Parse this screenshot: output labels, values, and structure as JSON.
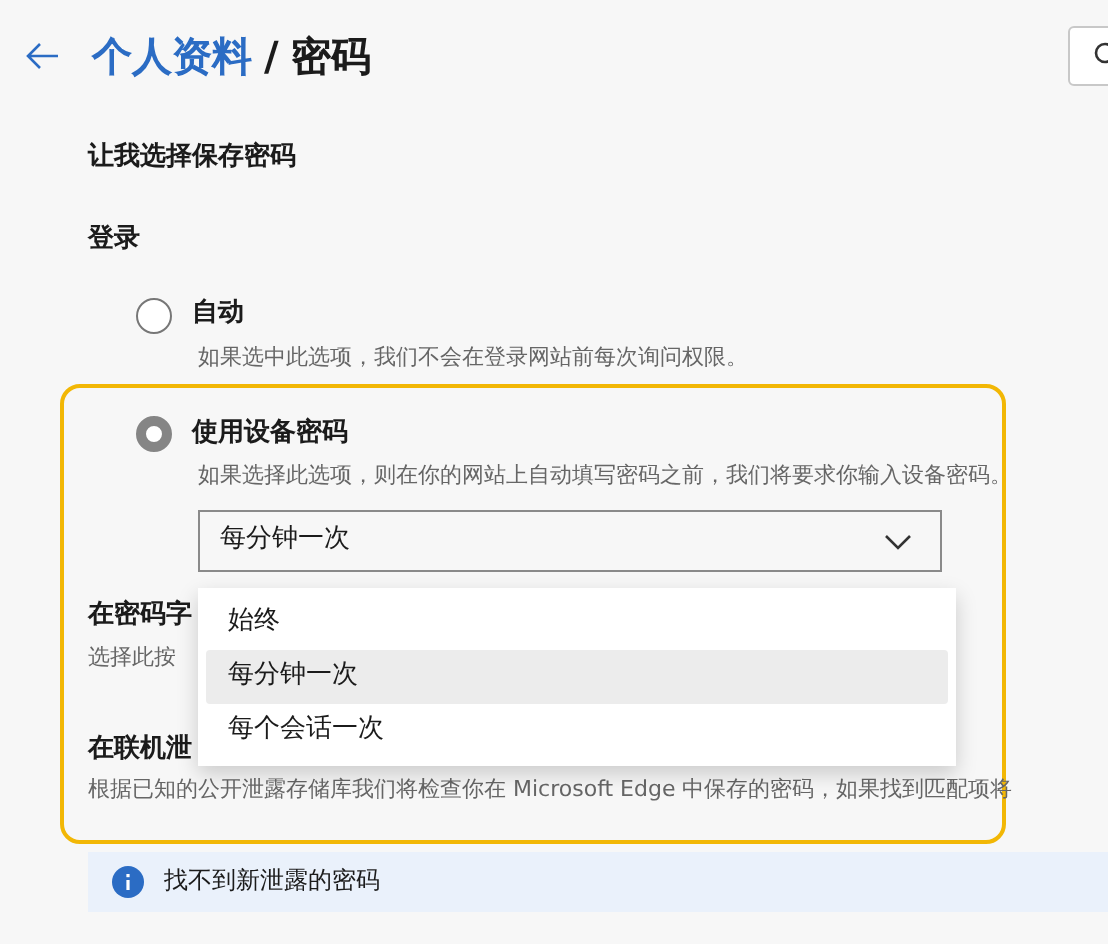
{
  "header": {
    "parent": "个人资料",
    "separator": "/",
    "title": "密码"
  },
  "offer_to_save": {
    "label": "让我选择保存密码"
  },
  "sign_in": {
    "heading": "登录",
    "options": [
      {
        "label": "自动",
        "description": "如果选中此选项，我们不会在登录网站前每次询问权限。",
        "selected": false
      },
      {
        "label": "使用设备密码",
        "description": "如果选择此选项，则在你的网站上自动填写密码之前，我们将要求你输入设备密码。",
        "selected": true
      }
    ],
    "frequency": {
      "value": "每分钟一次",
      "expanded": true,
      "options": [
        {
          "label": "始终",
          "selected": false
        },
        {
          "label": "每分钟一次",
          "selected": true
        },
        {
          "label": "每个会话一次",
          "selected": false
        }
      ]
    }
  },
  "settings": [
    {
      "title": "在密码字",
      "description": "选择此按"
    },
    {
      "title": "在联机泄",
      "description": "根据已知的公开泄露存储库我们将检查你在 Microsoft Edge 中保存的密码，如果找到匹配项将"
    }
  ],
  "notice": {
    "text": "找不到新泄露的密码"
  }
}
